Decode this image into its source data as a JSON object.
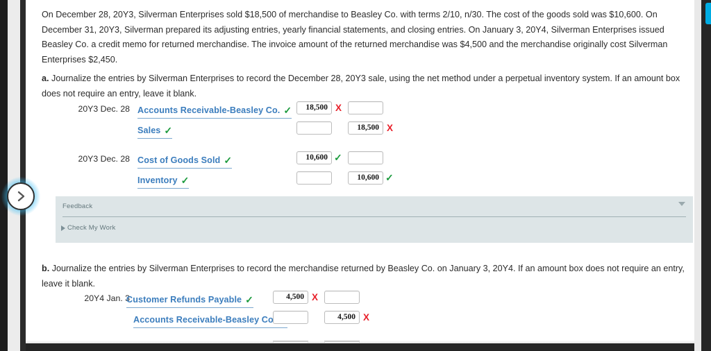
{
  "problem": {
    "intro": "On December 28, 20Y3, Silverman Enterprises sold $18,500 of merchandise to Beasley Co. with terms 2/10, n/30. The cost of the goods sold was $10,600. On December 31, 20Y3, Silverman prepared its adjusting entries, yearly financial statements, and closing entries. On January 3, 20Y4, Silverman Enterprises issued Beasley Co. a credit memo for returned merchandise. The invoice amount of the returned merchandise was $4,500 and the merchandise originally cost Silverman Enterprises $2,450."
  },
  "questions": {
    "a": {
      "label": "a.",
      "text": "Journalize the entries by Silverman Enterprises to record the December 28, 20Y3 sale, using the net method under a perpetual inventory system. If an amount box does not require an entry, leave it blank.",
      "entries": [
        {
          "date": "20Y3 Dec. 28",
          "account": "Accounts Receivable-Beasley Co.",
          "account_status": "check",
          "indent": 0,
          "debit": "18,500",
          "debit_status": "cross",
          "credit": "",
          "credit_status": "none"
        },
        {
          "date": "",
          "account": "Sales",
          "account_status": "check",
          "indent": 1,
          "debit": "",
          "debit_status": "none",
          "credit": "18,500",
          "credit_status": "cross"
        },
        {
          "date": "20Y3 Dec. 28",
          "account": "Cost of Goods Sold",
          "account_status": "check",
          "indent": 0,
          "debit": "10,600",
          "debit_status": "check",
          "credit": "",
          "credit_status": "none"
        },
        {
          "date": "",
          "account": "Inventory",
          "account_status": "check",
          "indent": 1,
          "debit": "",
          "debit_status": "none",
          "credit": "10,600",
          "credit_status": "check"
        }
      ]
    },
    "b": {
      "label": "b.",
      "text": "Journalize the entries by Silverman Enterprises to record the merchandise returned by Beasley Co. on January 3, 20Y4. If an amount box does not require an entry, leave it blank.",
      "entries": [
        {
          "date": "20Y4 Jan. 3",
          "account": "Customer Refunds Payable",
          "account_status": "check",
          "indent": 0,
          "debit": "4,500",
          "debit_status": "cross",
          "credit": "",
          "credit_status": "none"
        },
        {
          "date": "",
          "account": "Accounts Receivable-Beasley Co.",
          "account_status": "check",
          "indent": 1,
          "debit": "",
          "debit_status": "none",
          "credit": "4,500",
          "credit_status": "cross"
        }
      ]
    }
  },
  "feedback": {
    "title": "Feedback",
    "collapse_icon": "chevron-down-icon",
    "check_my_work": "Check My Work",
    "check_my_work_icon": "triangle-right-icon"
  },
  "navigation": {
    "next_button_icon": "chevron-right-icon"
  },
  "marks": {
    "check": "✓",
    "cross": "X"
  },
  "colors": {
    "account_link": "#3b7dbd",
    "correct": "#1a9a3c",
    "incorrect": "#e8202a",
    "feedback_bg": "#dde5e7",
    "accent_blue": "#00ace3"
  }
}
